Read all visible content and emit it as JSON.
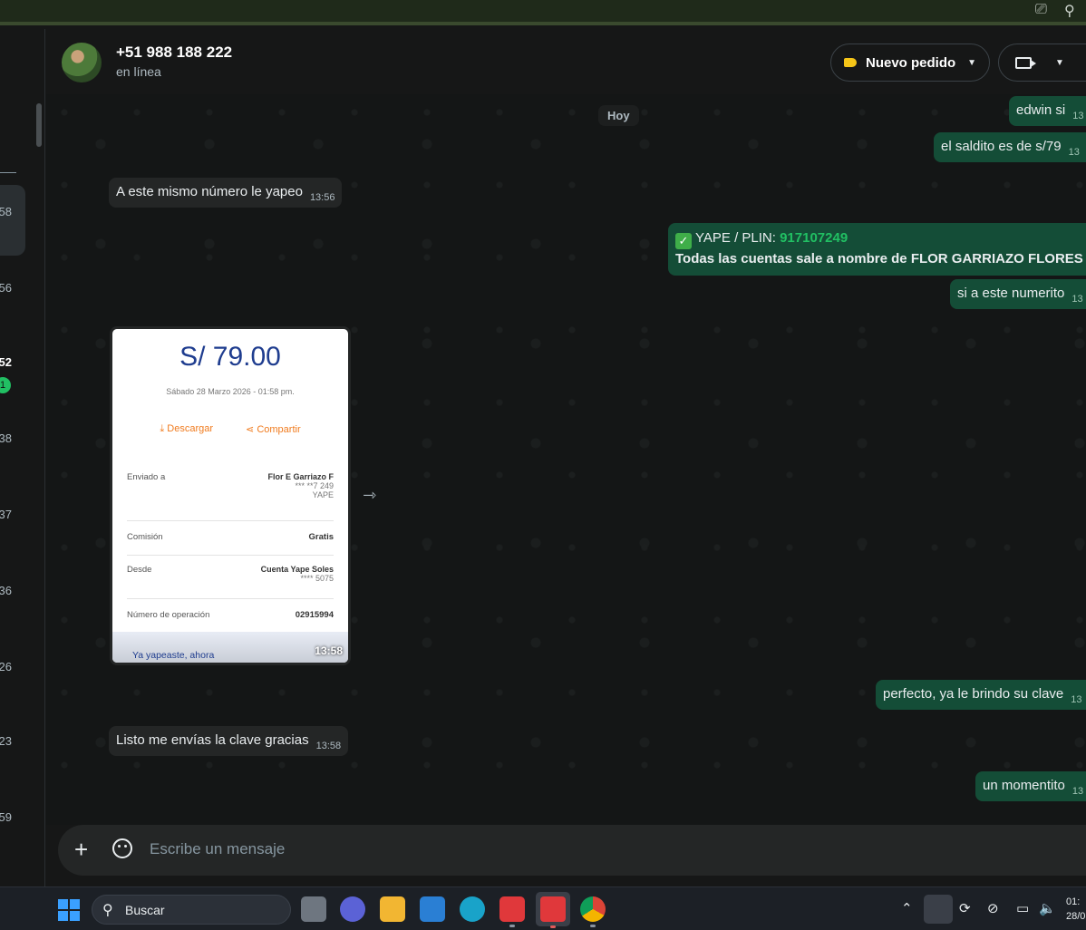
{
  "contact": {
    "name": "+51 988 188 222",
    "status": "en línea"
  },
  "header": {
    "new_order_label": "Nuevo pedido"
  },
  "date_chip": "Hoy",
  "left_list": {
    "times": [
      "58",
      "56",
      "52",
      "38",
      "37",
      "36",
      "26",
      "23",
      "59"
    ],
    "badge": "1"
  },
  "messages": {
    "out1": {
      "text": "edwin si",
      "time": "13"
    },
    "out2": {
      "text": "el saldito es de s/79",
      "time": "13"
    },
    "in1": {
      "text": "A este mismo número le yapeo",
      "time": "13:56"
    },
    "out3": {
      "line1_prefix": "YAPE / PLIN: ",
      "line1_number": "917107249",
      "line2": "Todas las cuentas sale a nombre de FLOR GARRIAZO FLORES",
      "time": "13"
    },
    "out4": {
      "text": "si a este numerito",
      "time": "13"
    },
    "out5": {
      "text": "perfecto, ya le brindo su clave",
      "time": "13"
    },
    "in2": {
      "text": "Listo me envías la clave gracias",
      "time": "13:58"
    },
    "out6": {
      "text": "un momentito",
      "time": "13"
    }
  },
  "receipt": {
    "amount": "S/ 79.00",
    "date": "Sábado 28 Marzo 2026 - 01:58 pm.",
    "download": "Descargar",
    "share": "Compartir",
    "sent_to_label": "Enviado a",
    "sent_to_name": "Flor E Garriazo F",
    "sent_to_phone": "*** **7 249",
    "sent_to_method": "YAPE",
    "commission_label": "Comisión",
    "commission_value": "Gratis",
    "from_label": "Desde",
    "from_value": "Cuenta Yape Soles",
    "from_account": "**** 5075",
    "op_label": "Número de operación",
    "op_value": "02915994",
    "footer_text": "Ya yapeaste, ahora",
    "time": "13:58"
  },
  "composer": {
    "placeholder": "Escribe un mensaje"
  },
  "taskbar": {
    "search_label": "Buscar",
    "clock_time": "01:",
    "clock_date": "28/0"
  }
}
